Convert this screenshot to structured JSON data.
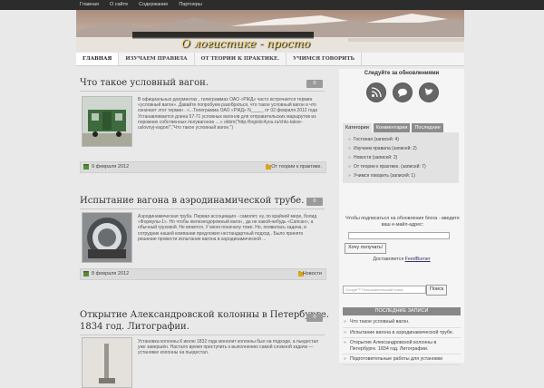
{
  "topnav": [
    "Главная",
    "О сайте",
    "Содержание",
    "Партнеры"
  ],
  "site_title": "О логистике - просто",
  "mainnav": [
    "ГЛАВНАЯ",
    "ИЗУЧАЕМ ПРАВИЛА",
    "ОТ ТЕОРИИ К ПРАКТИКЕ.",
    "УЧИМСЯ ГОВОРИТЬ"
  ],
  "posts": [
    {
      "title": "Что такое условный вагон.",
      "comments": "0",
      "excerpt": "В официальных документах , телеграммах ОАО «РЖД» часто встречается термин «условный вагон». Давайте попробуем разобраться, что такое условный вагон и что означает этот термин . «...Телеграмма ОАО «РЖД» N_____ от 02 февраля 2012 года Устанавливается длина 57-71 условных вагонов для отправительских маршрутов из порожних собственных полувагонов ....» okbm(\"http://logistic4you.ru/chto-takoe-uslovnyj-vagon/\",\"Что такое условный вагон.\")",
      "date": "9 февраля 2012",
      "category": "От теории к практике."
    },
    {
      "title": "Испытание вагона в аэродинамической трубе.",
      "comments": "0",
      "excerpt": "Аэродинамическая труба. Первая ассоциация - самолет, ну, по крайней мере, болид «Формулы-1». Но чтобы железнодорожный вагон , да не какой-нибудь «Сапсан», а обычный грузовой. Не вяжется. У меня поначалу тоже. Но, появилась задача, и сотрудник нашей компании предложил нестандартный подход . Было принято решение провести испытание вагона в аэродинамической ...",
      "date": "8 февраля 2012",
      "category": "Новости"
    },
    {
      "title": "Открытие Александровской колонны в Петербурге.",
      "title2": "1834 год. Литографии.",
      "comments": "0",
      "excerpt": "Установка колонны К июлю 1832 года монолит колонны был на подходе, а пьедестал уже завершён. Настало время приступить к выполнению самой сложной задачи — установке колонны на пьедестал."
    }
  ],
  "sidebar": {
    "follow_title": "Следуйте за обновлениями",
    "tabs": [
      "Категории",
      "Комментарии",
      "Последние"
    ],
    "categories": [
      "Гостиная (записей: 4)",
      "Изучаем правила (записей: 2)",
      "Новости (записей: 2)",
      "От теории к практике. (записей: 7)",
      "Учимся говорить (записей: 1)"
    ],
    "subscribe_text": "Чтобы подписаться на обновления блога - введите ваш е-майл-адрес:",
    "subscribe_button": "Хочу получать!",
    "delivered_text": "Доставляется",
    "feedburner": "FeedBurner",
    "search_placeholder": "Google™ Пользовательский поиск",
    "search_button": "Поиск",
    "recent_head": "ПОСЛЕДНИЕ ЗАПИСИ",
    "recent": [
      "Что такое условный вагон.",
      "Испытание вагона в аэродинамической трубе.",
      "Открытие Александровской колонны в Петербурге. 1834 год. Литографии.",
      "Подготовительные работы для установки"
    ]
  },
  "colors": {
    "accent": "#f2d25a",
    "dark_bar": "#2c2c2c",
    "meta_bar": "#dcdcdc"
  }
}
